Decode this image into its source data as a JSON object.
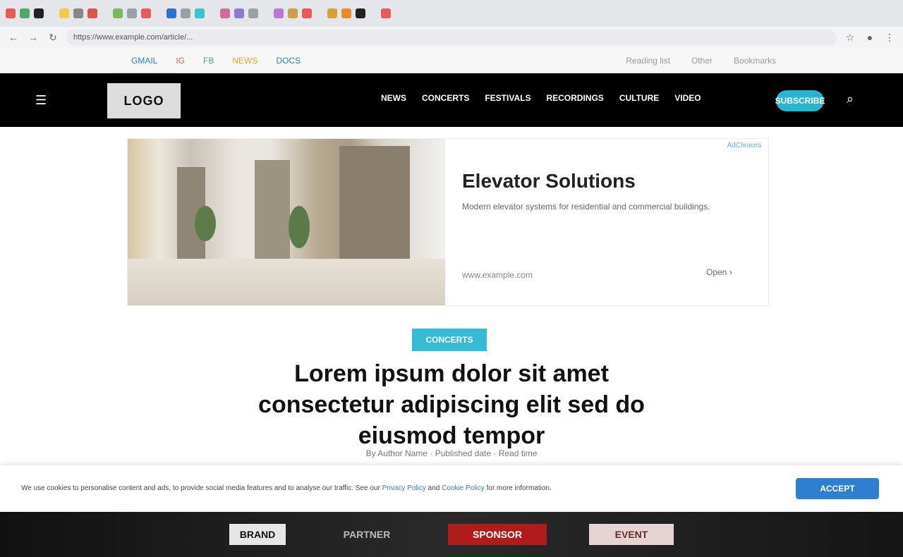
{
  "browser": {
    "tab_favicon_colors": [
      "#e45b5b",
      "#4fa86b",
      "#222222",
      "#f2c94c",
      "#888888",
      "#d9534f",
      "#7bb661",
      "#9aa0a6",
      "#e45b5b",
      "#2f6fd0",
      "#9aa0a6",
      "#39c5cf",
      "#d06b9e",
      "#8e7ad1",
      "#9aa0a6",
      "#b57ad1",
      "#c9a14a",
      "#e45b5b",
      "#d7a13a",
      "#e58b2e",
      "#222222",
      "#e45b5b"
    ],
    "url": "https://www.example.com/article/...",
    "bookmarks": [
      {
        "label": "GMAIL",
        "color": "#2f7fd0"
      },
      {
        "label": "IG",
        "color": "#e45b5b"
      },
      {
        "label": "FB",
        "color": "#4fa86b"
      },
      {
        "label": "NEWS",
        "color": "#e3a52f"
      },
      {
        "label": "DOCS",
        "color": "#2f7fd0"
      }
    ],
    "bookmarks_right": [
      "Reading list",
      "Other",
      "Bookmarks"
    ]
  },
  "site": {
    "logo": "LOGO",
    "nav": [
      "NEWS",
      "CONCERTS",
      "FESTIVALS",
      "RECORDINGS",
      "CULTURE",
      "VIDEO"
    ],
    "subscribe": "SUBSCRIBE",
    "accent_color": "#27b6d0"
  },
  "ad": {
    "title": "Elevator Solutions",
    "description": "Modern elevator systems for residential and commercial buildings.",
    "domain": "www.example.com",
    "cta": "Open",
    "adchoices": "AdChoices"
  },
  "article": {
    "tag": "CONCERTS",
    "headline": "Lorem ipsum dolor sit amet consectetur adipiscing elit sed do eiusmod tempor",
    "byline": "By Author Name · Published date · Read time"
  },
  "cookie": {
    "text_before": "We use cookies to personalise content and ads, to provide social media features and to analyse our traffic. See our ",
    "link1": "Privacy Policy",
    "text_middle": " and ",
    "link2": "Cookie Policy",
    "text_after": " for more information.",
    "accept_label": "ACCEPT"
  },
  "footer": {
    "items": [
      {
        "label": "BRAND",
        "color": "#ffffff",
        "bg": "#e6e6e6",
        "fg": "#111111"
      },
      {
        "label": "PARTNER",
        "color": "#bbbbbb",
        "bg": "transparent",
        "fg": "#bbbbbb"
      },
      {
        "label": "SPONSOR",
        "color": "#cc2222",
        "bg": "#b21b1b",
        "fg": "#ffffff"
      },
      {
        "label": "EVENT",
        "color": "#e6c9c9",
        "bg": "#e6d3d3",
        "fg": "#6a2a2a"
      }
    ]
  }
}
